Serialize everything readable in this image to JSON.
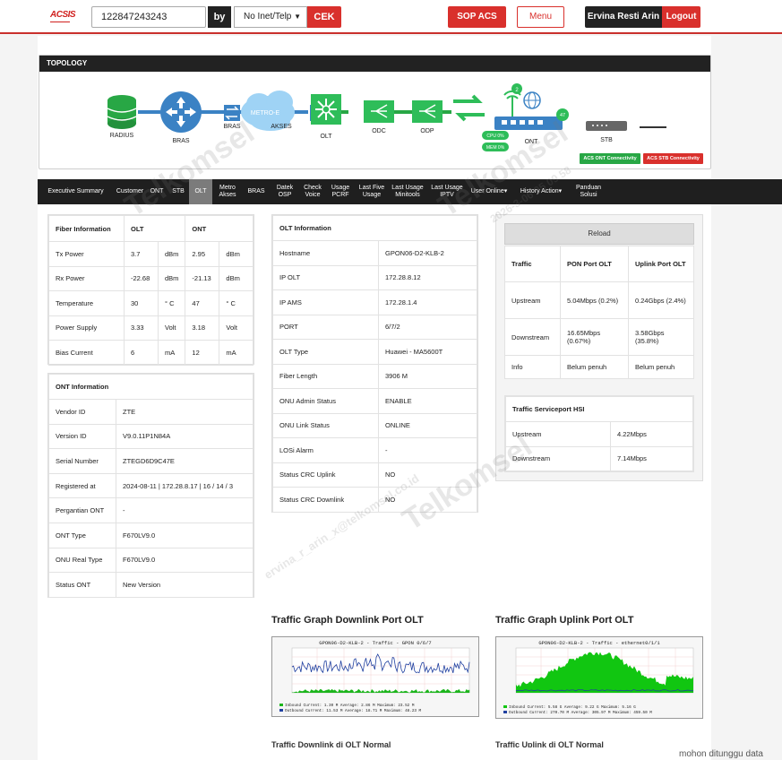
{
  "header": {
    "logo": "ACSIS",
    "search_value": "122847243243",
    "by_label": "by",
    "search_type": "No Inet/Telp",
    "cek_label": "CEK",
    "sop_label": "SOP ACS",
    "menu_label": "Menu",
    "user_name": "Ervina Resti Arin",
    "logout_label": "Logout"
  },
  "topology": {
    "title": "TOPOLOGY",
    "nodes": {
      "radius": "RADIUS",
      "bras": "BRAS",
      "bras2": "BRAS",
      "metro": "METRO-E",
      "akses": "AKSES",
      "olt": "OLT",
      "odc": "ODC",
      "odp": "ODP",
      "ont": "ONT",
      "stb": "STB"
    },
    "wifi_count": "2",
    "lan_count": "47",
    "cpu": "CPU 0%",
    "mem": "MEM 0%",
    "acs_ont": "ACS ONT Connectivity",
    "acs_stb": "ACS STB Connectivity",
    "colors": {
      "ok": "#28a745",
      "fail": "#d9302c",
      "link": "#3b82c4"
    }
  },
  "tabs": [
    "Executive Summary",
    "Customer",
    "ONT",
    "STB",
    "OLT",
    "Metro Akses",
    "BRAS",
    "Datek OSP",
    "Check Voice",
    "Usage PCRF",
    "Last Five Usage",
    "Last Usage Minitools",
    "Last Usage IPTV",
    "User Online",
    "History Action",
    "Panduan Solusi"
  ],
  "active_tab": "OLT",
  "fiber": {
    "title": "Fiber Information",
    "col_olt": "OLT",
    "col_ont": "ONT",
    "rows": [
      {
        "label": "Tx Power",
        "olt": "3.7",
        "olt_unit": "dBm",
        "ont": "2.95",
        "ont_unit": "dBm"
      },
      {
        "label": "Rx Power",
        "olt": "-22.68",
        "olt_unit": "dBm",
        "ont": "-21.13",
        "ont_unit": "dBm"
      },
      {
        "label": "Temperature",
        "olt": "30",
        "olt_unit": "° C",
        "ont": "47",
        "ont_unit": "° C"
      },
      {
        "label": "Power Supply",
        "olt": "3.33",
        "olt_unit": "Volt",
        "ont": "3.18",
        "ont_unit": "Volt"
      },
      {
        "label": "Bias Current",
        "olt": "6",
        "olt_unit": "mA",
        "ont": "12",
        "ont_unit": "mA"
      }
    ]
  },
  "ont_info": {
    "title": "ONT Information",
    "rows": [
      {
        "label": "Vendor ID",
        "value": "ZTE"
      },
      {
        "label": "Version ID",
        "value": "V9.0.11P1N84A"
      },
      {
        "label": "Serial Number",
        "value": "ZTEGD6D9C47E"
      },
      {
        "label": "Registered at",
        "value": "2024-08-11 | 172.28.8.17 | 16 / 14 / 3"
      },
      {
        "label": "Pergantian ONT",
        "value": "-"
      },
      {
        "label": "ONT Type",
        "value": "F670LV9.0"
      },
      {
        "label": "ONU Real Type",
        "value": "F670LV9.0"
      },
      {
        "label": "Status ONT",
        "value": "New Version"
      }
    ]
  },
  "olt_info": {
    "title": "OLT Information",
    "rows": [
      {
        "label": "Hostname",
        "value": "GPON06-D2-KLB-2"
      },
      {
        "label": "IP OLT",
        "value": "172.28.8.12"
      },
      {
        "label": "IP AMS",
        "value": "172.28.1.4"
      },
      {
        "label": "PORT",
        "value": "6/7/2"
      },
      {
        "label": "OLT Type",
        "value": "Huawei - MA5600T"
      },
      {
        "label": "Fiber Length",
        "value": "3906 M"
      },
      {
        "label": "ONU Admin Status",
        "value": "ENABLE"
      },
      {
        "label": "ONU Link Status",
        "value": "ONLINE"
      },
      {
        "label": "LOSi Alarm",
        "value": "-"
      },
      {
        "label": "Status CRC Uplink",
        "value": "NO"
      },
      {
        "label": "Status CRC Downlink",
        "value": "NO"
      }
    ]
  },
  "traffic": {
    "reload_label": "Reload",
    "col_traffic": "Traffic",
    "col_pon": "PON Port OLT",
    "col_uplink": "Uplink Port OLT",
    "rows": [
      {
        "label": "Upstream",
        "pon": "5.04Mbps (0.2%)",
        "uplink": "0.24Gbps (2.4%)"
      },
      {
        "label": "Downstream",
        "pon": "16.65Mbps (0.67%)",
        "uplink": "3.58Gbps (35.8%)"
      },
      {
        "label": "Info",
        "pon": "Belum penuh",
        "uplink": "Belum penuh"
      }
    ]
  },
  "hsi": {
    "title": "Traffic Serviceport HSI",
    "rows": [
      {
        "label": "Upstream",
        "value": "4.22Mbps"
      },
      {
        "label": "Downstream",
        "value": "7.14Mbps"
      }
    ]
  },
  "graphs": {
    "downlink_title": "Traffic Graph Downlink Port OLT",
    "uplink_title": "Traffic Graph Uplink Port OLT",
    "downlink_caption": "GPON06-D2-KLB-2 - Traffic - GPON 0/6/7",
    "uplink_caption": "GPON06-D2-KLB-2 - Traffic - ethernet0/1/1",
    "downlink_legend_in": "Inbound  Current:  1.30 M   Average:  2.86 M   Maximum:  23.52 M",
    "downlink_legend_out": "Outbound Current:  11.53 M  Average:  18.71 M  Maximum:  48.23 M",
    "uplink_legend_in": "Inbound  Current:  5.58 G  Average:  9.22 G  Maximum:  5.16 G",
    "uplink_legend_out": "Outbound Current:  270.70 M  Average:  305.97 M  Maximum:  459.50 M",
    "downlink_normal": "Traffic Downlink di OLT Normal",
    "uplink_normal": "Traffic Uplink di OLT Normal"
  },
  "footer_note": "mohon ditunggu data",
  "watermark": {
    "brand": "Telkomsel",
    "email": "ervina_r_arin_x@telkomsel.co.id",
    "stamp": "2026-3-06 05 09 58"
  }
}
